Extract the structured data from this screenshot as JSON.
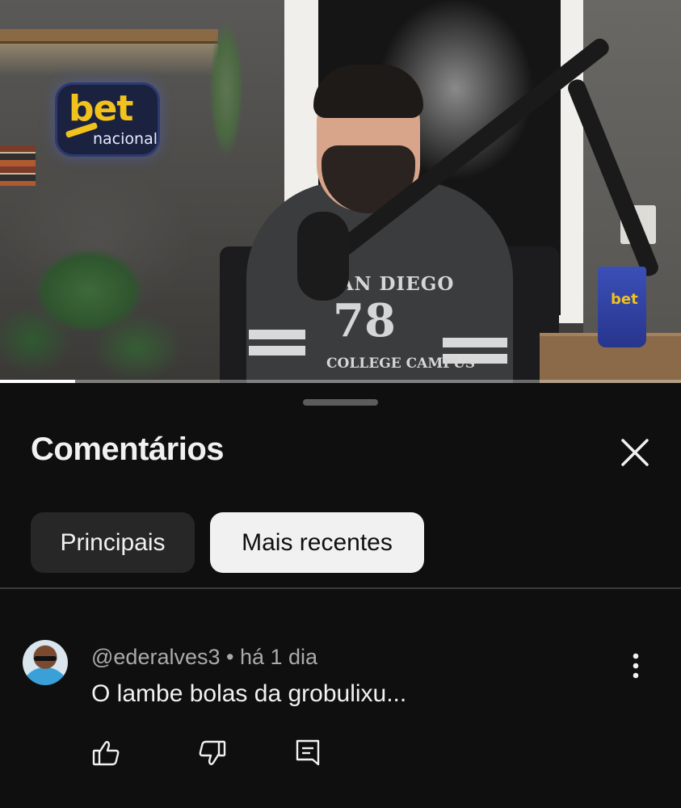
{
  "video": {
    "sign_brand_top": "bet",
    "sign_brand_bottom": "nacional",
    "shirt_line1": "SAN DIEGO",
    "shirt_number": "78",
    "shirt_line2": "COLLEGE CAMPUS",
    "cup_logo": "bet",
    "progress_fraction": 0.11
  },
  "sheet": {
    "title": "Comentários",
    "close_icon": "close-icon",
    "chips": [
      {
        "label": "Principais",
        "selected": false
      },
      {
        "label": "Mais recentes",
        "selected": true
      }
    ]
  },
  "comments": [
    {
      "author": "@ederalves3",
      "separator": "•",
      "age": "há 1 dia",
      "text": "O lambe bolas da grobulixu..."
    }
  ],
  "colors": {
    "background": "#0f0f0f",
    "chip_selected_bg": "#f1f1f1",
    "chip_unselected_bg": "#272727",
    "meta_text": "#aaaaaa"
  },
  "icons": [
    "close-icon",
    "more-vertical-icon",
    "thumbs-up-icon",
    "thumbs-down-icon",
    "reply-icon"
  ]
}
